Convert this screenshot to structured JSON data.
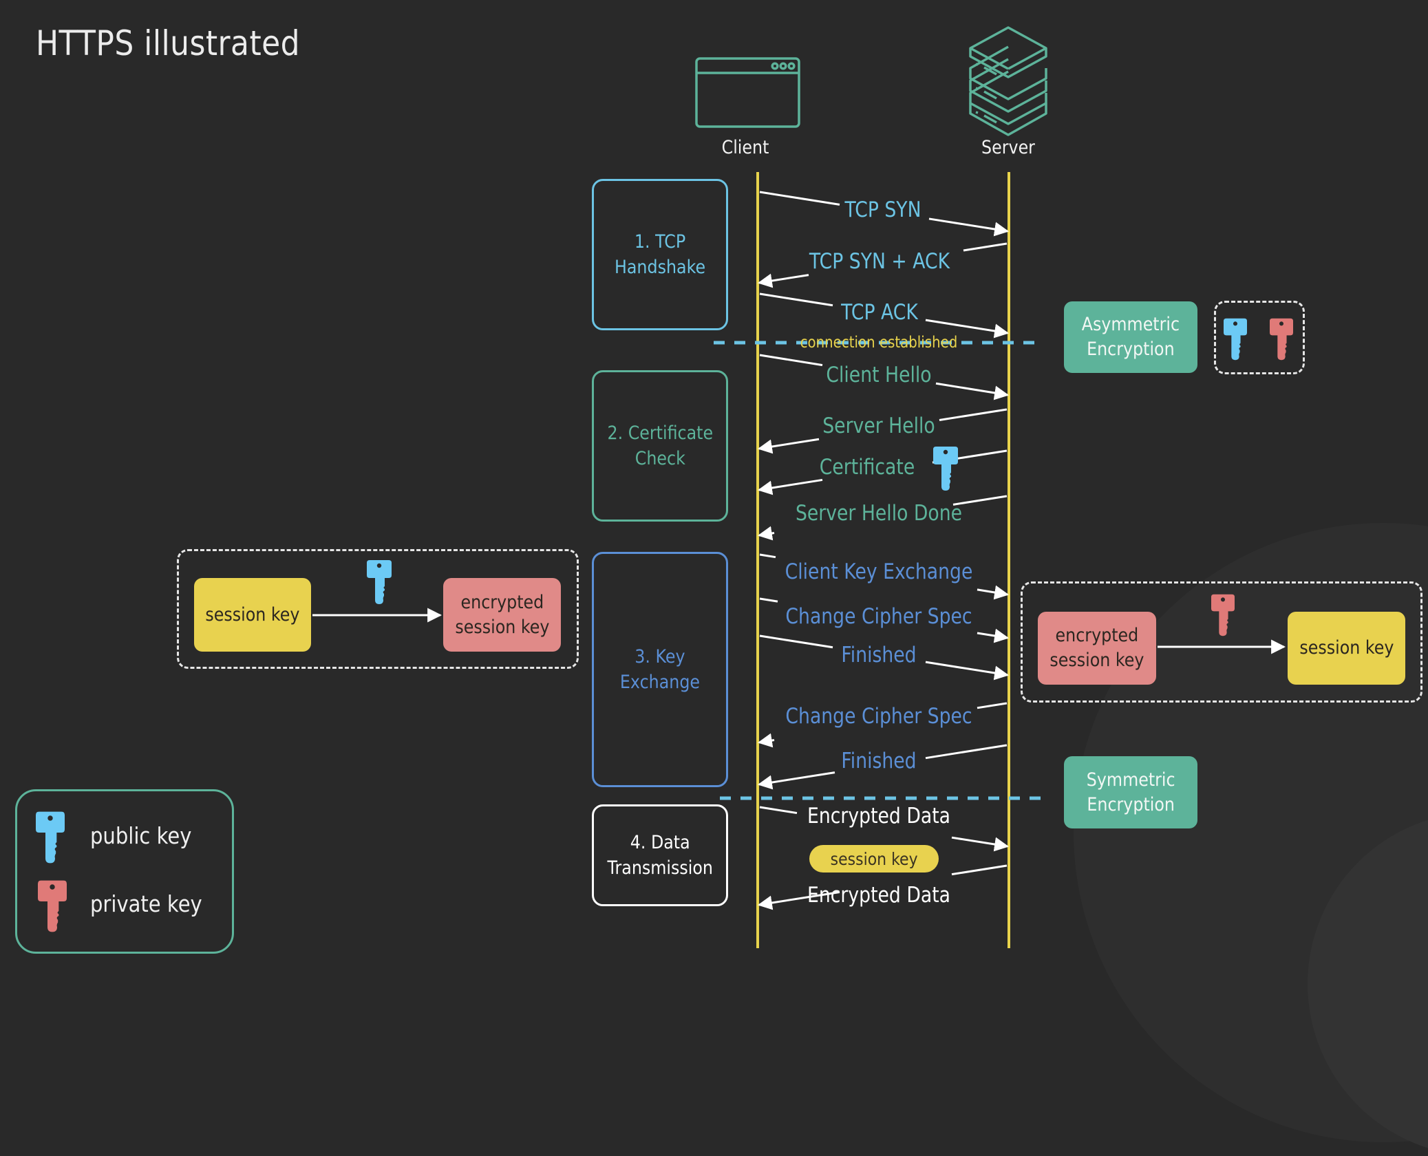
{
  "title": "HTTPS illustrated",
  "colors": {
    "background": "#292929",
    "lifeline": "#e8d34c",
    "arrow": "#ffffff",
    "tcp": "#6cc4e4",
    "certificate": "#5db39a",
    "key_exchange": "#5b8fd6",
    "data": "#ffffff",
    "divider": "#6cc4e4",
    "public_key": "#6ccaf5",
    "private_key": "#e07a78",
    "encryption_badge": "#5db39a",
    "session_key": "#e8d24f",
    "encrypted_session_key": "#e08a88"
  },
  "actors": {
    "client": {
      "label": "Client",
      "icon": "browser-window-icon"
    },
    "server": {
      "label": "Server",
      "icon": "server-stack-icon"
    }
  },
  "steps": [
    {
      "label": "1. TCP\nHandshake",
      "color": "#6cc4e4"
    },
    {
      "label": "2. Certificate\nCheck",
      "color": "#5db39a"
    },
    {
      "label": "3. Key\nExchange",
      "color": "#5b8fd6"
    },
    {
      "label": "4. Data\nTransmission",
      "color": "#ffffff"
    }
  ],
  "messages": [
    {
      "label": "TCP SYN",
      "direction": "client-to-server",
      "step": 1
    },
    {
      "label": "TCP SYN + ACK",
      "direction": "server-to-client",
      "step": 1
    },
    {
      "label": "TCP ACK",
      "direction": "client-to-server",
      "step": 1
    },
    {
      "label": "Client Hello",
      "direction": "client-to-server",
      "step": 2
    },
    {
      "label": "Server Hello",
      "direction": "server-to-client",
      "step": 2
    },
    {
      "label": "Certificate",
      "direction": "server-to-client",
      "step": 2,
      "attachment": "public-key-icon"
    },
    {
      "label": "Server Hello Done",
      "direction": "server-to-client",
      "step": 2
    },
    {
      "label": "Client Key Exchange",
      "direction": "client-to-server",
      "step": 3
    },
    {
      "label": "Change Cipher Spec",
      "direction": "client-to-server",
      "step": 3
    },
    {
      "label": "Finished",
      "direction": "client-to-server",
      "step": 3
    },
    {
      "label": "Change Cipher Spec",
      "direction": "server-to-client",
      "step": 3
    },
    {
      "label": "Finished",
      "direction": "server-to-client",
      "step": 3
    },
    {
      "label": "Encrypted Data",
      "direction": "client-to-server",
      "step": 4
    },
    {
      "label": "Encrypted Data",
      "direction": "server-to-client",
      "step": 4
    }
  ],
  "dividers": {
    "connection_established": "connection established"
  },
  "badges": {
    "asymmetric": "Asymmetric\nEncryption",
    "symmetric": "Symmetric\nEncryption"
  },
  "data_pill": "session key",
  "client_side_encrypt": {
    "from": "session key",
    "key": "public-key-icon",
    "to": "encrypted\nsession key"
  },
  "server_side_decrypt": {
    "from": "encrypted\nsession key",
    "key": "private-key-icon",
    "to": "session key"
  },
  "legend": {
    "items": [
      {
        "icon": "public-key-icon",
        "label": "public key"
      },
      {
        "icon": "private-key-icon",
        "label": "private key"
      }
    ]
  }
}
